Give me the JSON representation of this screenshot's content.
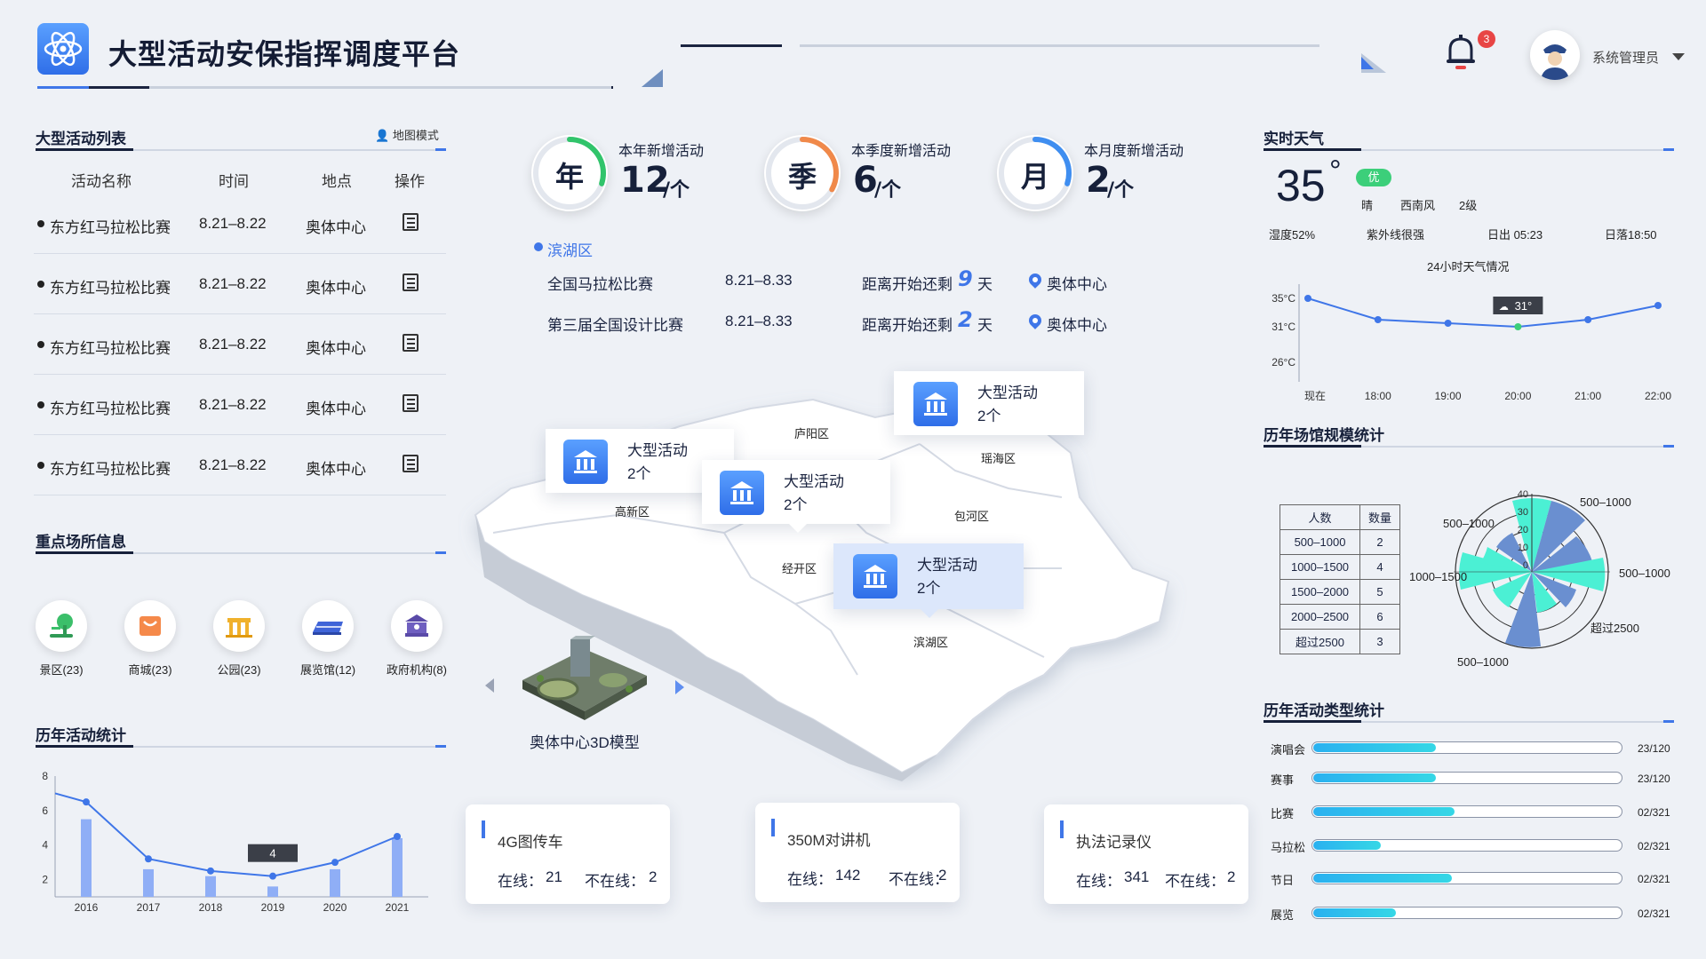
{
  "header": {
    "title": "大型活动安保指挥调度平台",
    "notification_count": "3",
    "user_name": "系统管理员"
  },
  "activity_list": {
    "title": "大型活动列表",
    "map_mode": "地图模式",
    "columns": [
      "活动名称",
      "时间",
      "地点",
      "操作"
    ],
    "rows": [
      {
        "name": "东方红马拉松比赛",
        "time": "8.21–8.22",
        "place": "奥体中心"
      },
      {
        "name": "东方红马拉松比赛",
        "time": "8.21–8.22",
        "place": "奥体中心"
      },
      {
        "name": "东方红马拉松比赛",
        "time": "8.21–8.22",
        "place": "奥体中心"
      },
      {
        "name": "东方红马拉松比赛",
        "time": "8.21–8.22",
        "place": "奥体中心"
      },
      {
        "name": "东方红马拉松比赛",
        "time": "8.21–8.22",
        "place": "奥体中心"
      }
    ]
  },
  "key_places": {
    "title": "重点场所信息",
    "items": [
      {
        "label": "景区(23)",
        "icon": "tree-icon"
      },
      {
        "label": "商城(23)",
        "icon": "shopping-bag-icon"
      },
      {
        "label": "公园(23)",
        "icon": "park-gate-icon"
      },
      {
        "label": "展览馆(12)",
        "icon": "exhibition-icon"
      },
      {
        "label": "政府机构(8)",
        "icon": "government-icon"
      }
    ]
  },
  "yearly_activity": {
    "title": "历年活动统计",
    "tooltip": "4"
  },
  "stats": [
    {
      "char": "年",
      "label": "本年新增活动",
      "value": "12",
      "unit": "/个",
      "color": "#31c46b",
      "fraction": 0.3
    },
    {
      "char": "季",
      "label": "本季度新增活动",
      "value": "6",
      "unit": "/个",
      "color": "#f0894a",
      "fraction": 0.33
    },
    {
      "char": "月",
      "label": "本月度新增活动",
      "value": "2",
      "unit": "/个",
      "color": "#3f8ef0",
      "fraction": 0.3
    }
  ],
  "district_events": {
    "district": "滨湖区",
    "rows": [
      {
        "name": "全国马拉松比赛",
        "time": "8.21–8.33",
        "countdown_prefix": "距离开始还剩",
        "days": "9",
        "suffix": "天",
        "place": "奥体中心"
      },
      {
        "name": "第三届全国设计比赛",
        "time": "8.21–8.33",
        "countdown_prefix": "距离开始还剩",
        "days": "2",
        "suffix": "天",
        "place": "奥体中心"
      }
    ]
  },
  "map": {
    "districts": [
      "庐阳区",
      "瑶海区",
      "高新区",
      "包河区",
      "经开区",
      "滨湖区"
    ],
    "cards": [
      {
        "title": "大型活动",
        "count": "2个"
      },
      {
        "title": "大型活动",
        "count": "2个"
      },
      {
        "title": "大型活动",
        "count": "2个"
      },
      {
        "title": "大型活动",
        "count": "2个"
      }
    ],
    "model_label": "奥体中心3D模型"
  },
  "devices": [
    {
      "name": "4G图传车",
      "online_label": "在线：",
      "online": "21",
      "offline_label": "不在线：",
      "offline": "2"
    },
    {
      "name": "350M对讲机",
      "online_label": "在线：",
      "online": "142",
      "offline_label": "不在线：",
      "offline": "2"
    },
    {
      "name": "执法记录仪",
      "online_label": "在线：",
      "online": "341",
      "offline_label": "不在线：",
      "offline": "2"
    }
  ],
  "weather": {
    "title": "实时天气",
    "temperature": "35",
    "degree": "°",
    "quality": "优",
    "condition": "晴",
    "wind": "西南风",
    "wind_level": "2级",
    "humidity": "湿度52%",
    "uv": "紫外线很强",
    "sunrise": "日出 05:23",
    "sunset": "日落18:50",
    "chart_title": "24小时天气情况",
    "tooltip": "31°"
  },
  "venue_scale": {
    "title": "历年场馆规模统计",
    "table_headers": [
      "人数",
      "数量"
    ],
    "table_rows": [
      [
        "500–1000",
        "2"
      ],
      [
        "1000–1500",
        "4"
      ],
      [
        "1500–2000",
        "5"
      ],
      [
        "2000–2500",
        "6"
      ],
      [
        "超过2500",
        "3"
      ]
    ],
    "rose_labels": [
      "500–1000",
      "500–1000",
      "1000–1500",
      "500–1000",
      "超过2500",
      "500–1000"
    ],
    "radial_ticks": [
      "40",
      "30",
      "20",
      "10",
      "0"
    ]
  },
  "activity_types": {
    "title": "历年活动类型统计",
    "items": [
      {
        "label": "演唱会",
        "value": "23/120",
        "fraction": 0.4
      },
      {
        "label": "赛事",
        "value": "23/120",
        "fraction": 0.4
      },
      {
        "label": "比赛",
        "value": "02/321",
        "fraction": 0.46
      },
      {
        "label": "马拉松",
        "value": "02/321",
        "fraction": 0.22
      },
      {
        "label": "节日",
        "value": "02/321",
        "fraction": 0.45
      },
      {
        "label": "展览",
        "value": "02/321",
        "fraction": 0.27
      }
    ]
  },
  "chart_data": [
    {
      "type": "bar",
      "categories": [
        "2016",
        "2017",
        "2018",
        "2019",
        "2020",
        "2021"
      ],
      "series": [
        {
          "values": [
            5.5,
            2.6,
            2.2,
            1.6,
            2.6,
            4.4
          ]
        },
        {
          "values": [
            6.5,
            3.2,
            2.5,
            2.2,
            3.0,
            4.5
          ]
        }
      ],
      "ylim": [
        1,
        8
      ],
      "yticks": [
        "8",
        "6",
        "4",
        "2"
      ]
    },
    {
      "type": "line",
      "categories": [
        "现在",
        "18:00",
        "19:00",
        "20:00",
        "21:00",
        "22:00"
      ],
      "values": [
        35,
        32,
        31.5,
        31,
        32,
        34
      ],
      "yticks": [
        "35°C",
        "31°C",
        "26°C"
      ],
      "ylim": [
        25,
        37
      ]
    }
  ]
}
